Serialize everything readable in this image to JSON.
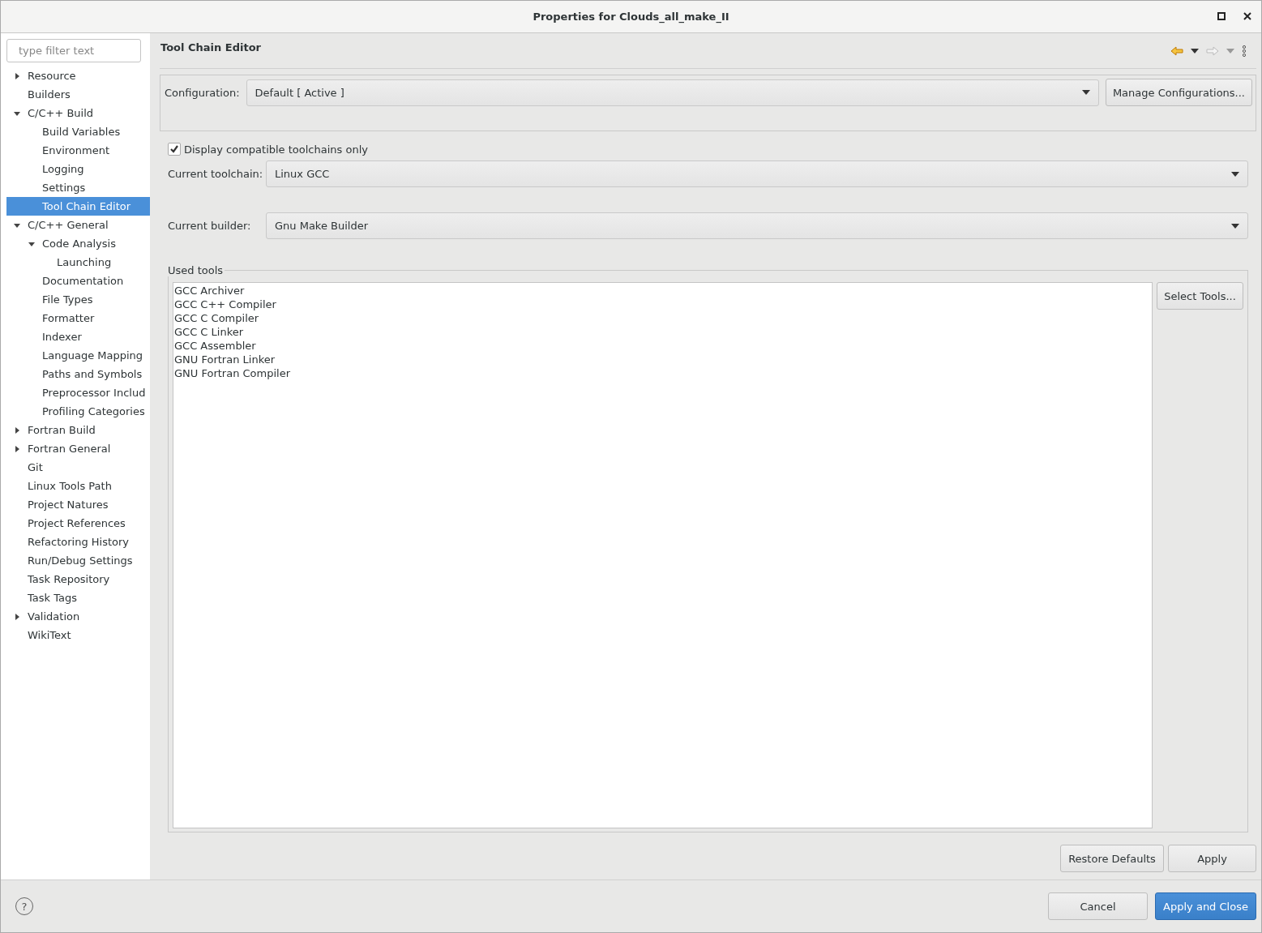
{
  "window": {
    "title": "Properties for Clouds_all_make_II"
  },
  "sidebar": {
    "filter": {
      "placeholder": "type filter text"
    },
    "tree": [
      {
        "label": "Resource",
        "expanded": false,
        "selected": false
      },
      {
        "label": "Builders",
        "selected": false
      },
      {
        "label": "C/C++ Build",
        "expanded": true,
        "selected": false,
        "children": [
          {
            "label": "Build Variables",
            "selected": false
          },
          {
            "label": "Environment",
            "selected": false
          },
          {
            "label": "Logging",
            "selected": false
          },
          {
            "label": "Settings",
            "selected": false
          },
          {
            "label": "Tool Chain Editor",
            "selected": true
          }
        ]
      },
      {
        "label": "C/C++ General",
        "expanded": true,
        "selected": false,
        "children": [
          {
            "label": "Code Analysis",
            "expanded": true,
            "selected": false,
            "children": [
              {
                "label": "Launching",
                "selected": false
              }
            ]
          },
          {
            "label": "Documentation",
            "selected": false
          },
          {
            "label": "File Types",
            "selected": false
          },
          {
            "label": "Formatter",
            "selected": false
          },
          {
            "label": "Indexer",
            "selected": false
          },
          {
            "label": "Language Mapping",
            "selected": false
          },
          {
            "label": "Paths and Symbols",
            "selected": false
          },
          {
            "label": "Preprocessor Includ",
            "selected": false
          },
          {
            "label": "Profiling Categories",
            "selected": false
          }
        ]
      },
      {
        "label": "Fortran Build",
        "expanded": false,
        "selected": false
      },
      {
        "label": "Fortran General",
        "expanded": false,
        "selected": false
      },
      {
        "label": "Git",
        "selected": false
      },
      {
        "label": "Linux Tools Path",
        "selected": false
      },
      {
        "label": "Project Natures",
        "selected": false
      },
      {
        "label": "Project References",
        "selected": false
      },
      {
        "label": "Refactoring History",
        "selected": false
      },
      {
        "label": "Run/Debug Settings",
        "selected": false
      },
      {
        "label": "Task Repository",
        "selected": false
      },
      {
        "label": "Task Tags",
        "selected": false
      },
      {
        "label": "Validation",
        "expanded": false,
        "selected": false
      },
      {
        "label": "WikiText",
        "selected": false
      }
    ]
  },
  "page": {
    "title": "Tool Chain Editor",
    "nav": {
      "back_enabled": true,
      "forward_enabled": false
    },
    "configuration": {
      "label": "Configuration:",
      "value": "Default  [ Active ]",
      "manage_button": "Manage Configurations..."
    },
    "compatible_only": {
      "label": "Display compatible toolchains only",
      "checked": true
    },
    "toolchain": {
      "label": "Current toolchain:",
      "value": "Linux GCC"
    },
    "builder": {
      "label": "Current builder:",
      "value": "Gnu Make Builder"
    },
    "used_tools": {
      "label": "Used tools",
      "items": [
        "GCC Archiver",
        "GCC C++ Compiler",
        "GCC C Compiler",
        "GCC C Linker",
        "GCC Assembler",
        "GNU Fortran Linker",
        "GNU Fortran Compiler"
      ],
      "select_button": "Select Tools..."
    },
    "buttons": [
      "Restore Defaults",
      "Apply"
    ]
  },
  "footer": {
    "help": "?",
    "buttons": [
      {
        "label": "Cancel",
        "primary": false
      },
      {
        "label": "Apply and Close",
        "primary": true
      }
    ]
  }
}
